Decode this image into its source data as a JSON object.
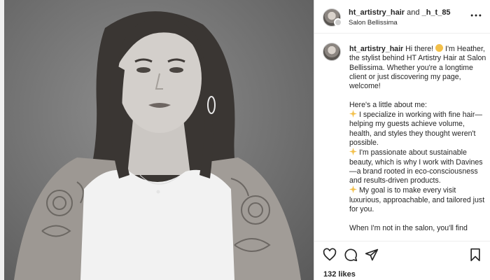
{
  "post": {
    "image_description_icon": "portrait-photo",
    "author_username": "ht_artistry_hair",
    "coauthor_joiner": "and",
    "coauthor_username": "_h_t_85",
    "location": "Salon Bellissima"
  },
  "caption": {
    "username": "ht_artistry_hair",
    "intro_line": "Hi there!",
    "intro_rest": "I'm Heather, the stylist behind HT Artistry Hair at Salon Bellissima. Whether you're a longtime client or just discovering my page, welcome!",
    "about_heading": "Here's a little about me:",
    "point1": "I specialize in working with fine hair—helping my guests achieve volume, health, and styles they thought weren't possible.",
    "point2": "I'm passionate about sustainable beauty, which is why I work with Davines—a brand rooted in eco-consciousness and results-driven products.",
    "point3": "My goal is to make every visit luxurious, approachable, and tailored just for you.",
    "closing": "When I'm not in the salon, you'll find"
  },
  "stats": {
    "likes": "132 likes"
  },
  "icons": {
    "more": "more-horizontal-icon",
    "like": "heart-icon",
    "comment": "comment-icon",
    "share": "send-icon",
    "save": "bookmark-icon",
    "wave": "waving-hand-emoji",
    "sparkles": "sparkles-emoji"
  },
  "colors": {
    "text": "#262626",
    "border": "#dbdbdb",
    "emoji": "#f3c04a"
  }
}
